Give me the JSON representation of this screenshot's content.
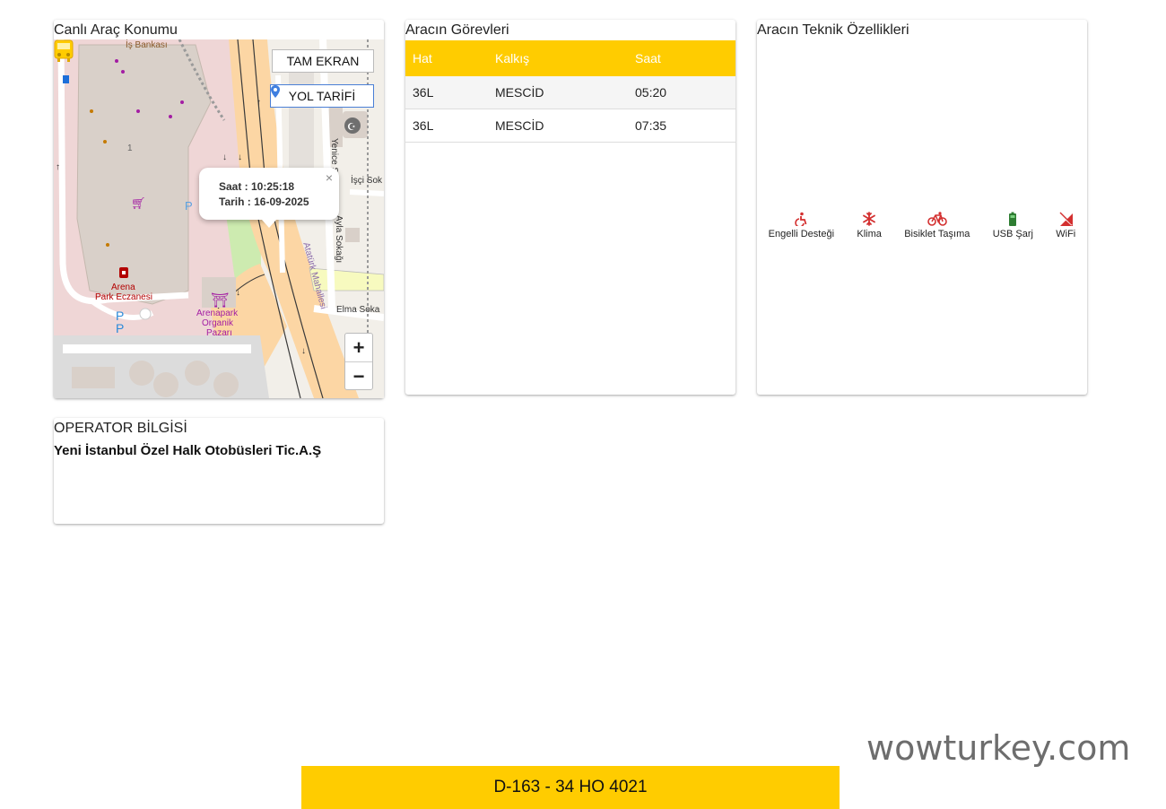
{
  "map_card": {
    "title": "Canlı Araç Konumu",
    "fullscreen_label": "TAM EKRAN",
    "route_label": "YOL TARİFİ",
    "zoom_in": "+",
    "zoom_out": "−",
    "popup": {
      "time_line": "Saat : 10:25:18",
      "date_line": "Tarih : 16-09-2025",
      "close": "×"
    },
    "labels": {
      "bank": "İş Bankası",
      "pharmacy": "Arena\nPark Eczanesi",
      "pharmacy_1": "Arena",
      "pharmacy_2": "Park Eczanesi",
      "market_1": "Arenapark",
      "market_2": "Organik",
      "market_3": "Pazarı",
      "street_elma": "Elma Soka",
      "street_isci": "İşçi Sok",
      "street_yenice": "Yenice Sokağı",
      "street_ayla": "Ayla Sokağı",
      "street_ataturk": "Atatürk Mahallesi",
      "parking": "P",
      "number": "1"
    }
  },
  "tasks_card": {
    "title": "Aracın Görevleri",
    "columns": [
      "Hat",
      "Kalkış",
      "Saat"
    ],
    "rows": [
      [
        "36L",
        "MESCİD",
        "05:20"
      ],
      [
        "36L",
        "MESCİD",
        "07:35"
      ]
    ]
  },
  "features_card": {
    "title": "Aracın Teknik Özellikleri",
    "features": [
      {
        "label": "Engelli Desteği",
        "icon": "wheelchair-icon",
        "color": "#d32f2f"
      },
      {
        "label": "Klima",
        "icon": "snowflake-icon",
        "color": "#d32f2f"
      },
      {
        "label": "Bisiklet Taşıma",
        "icon": "bicycle-icon",
        "color": "#d32f2f"
      },
      {
        "label": "USB Şarj",
        "icon": "battery-icon",
        "color": "#2e7d32"
      },
      {
        "label": "WiFi",
        "icon": "wifi-icon",
        "color": "#d32f2f"
      }
    ]
  },
  "operator_card": {
    "title": "OPERATOR BİLGİSİ",
    "name": "Yeni İstanbul Özel Halk Otobüsleri Tic.A.Ş"
  },
  "plate_bar": {
    "text": "D-163 - 34 HO 4021",
    "color": "#ffcc00"
  },
  "watermark": "wowturkey.com"
}
